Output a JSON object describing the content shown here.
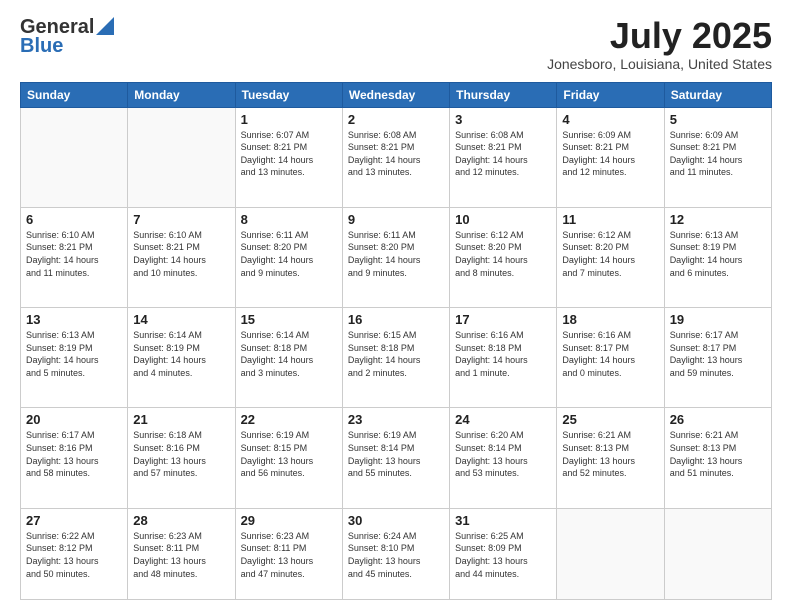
{
  "header": {
    "logo_line1": "General",
    "logo_line2": "Blue",
    "month_year": "July 2025",
    "location": "Jonesboro, Louisiana, United States"
  },
  "weekdays": [
    "Sunday",
    "Monday",
    "Tuesday",
    "Wednesday",
    "Thursday",
    "Friday",
    "Saturday"
  ],
  "weeks": [
    [
      {
        "day": "",
        "info": ""
      },
      {
        "day": "",
        "info": ""
      },
      {
        "day": "1",
        "info": "Sunrise: 6:07 AM\nSunset: 8:21 PM\nDaylight: 14 hours\nand 13 minutes."
      },
      {
        "day": "2",
        "info": "Sunrise: 6:08 AM\nSunset: 8:21 PM\nDaylight: 14 hours\nand 13 minutes."
      },
      {
        "day": "3",
        "info": "Sunrise: 6:08 AM\nSunset: 8:21 PM\nDaylight: 14 hours\nand 12 minutes."
      },
      {
        "day": "4",
        "info": "Sunrise: 6:09 AM\nSunset: 8:21 PM\nDaylight: 14 hours\nand 12 minutes."
      },
      {
        "day": "5",
        "info": "Sunrise: 6:09 AM\nSunset: 8:21 PM\nDaylight: 14 hours\nand 11 minutes."
      }
    ],
    [
      {
        "day": "6",
        "info": "Sunrise: 6:10 AM\nSunset: 8:21 PM\nDaylight: 14 hours\nand 11 minutes."
      },
      {
        "day": "7",
        "info": "Sunrise: 6:10 AM\nSunset: 8:21 PM\nDaylight: 14 hours\nand 10 minutes."
      },
      {
        "day": "8",
        "info": "Sunrise: 6:11 AM\nSunset: 8:20 PM\nDaylight: 14 hours\nand 9 minutes."
      },
      {
        "day": "9",
        "info": "Sunrise: 6:11 AM\nSunset: 8:20 PM\nDaylight: 14 hours\nand 9 minutes."
      },
      {
        "day": "10",
        "info": "Sunrise: 6:12 AM\nSunset: 8:20 PM\nDaylight: 14 hours\nand 8 minutes."
      },
      {
        "day": "11",
        "info": "Sunrise: 6:12 AM\nSunset: 8:20 PM\nDaylight: 14 hours\nand 7 minutes."
      },
      {
        "day": "12",
        "info": "Sunrise: 6:13 AM\nSunset: 8:19 PM\nDaylight: 14 hours\nand 6 minutes."
      }
    ],
    [
      {
        "day": "13",
        "info": "Sunrise: 6:13 AM\nSunset: 8:19 PM\nDaylight: 14 hours\nand 5 minutes."
      },
      {
        "day": "14",
        "info": "Sunrise: 6:14 AM\nSunset: 8:19 PM\nDaylight: 14 hours\nand 4 minutes."
      },
      {
        "day": "15",
        "info": "Sunrise: 6:14 AM\nSunset: 8:18 PM\nDaylight: 14 hours\nand 3 minutes."
      },
      {
        "day": "16",
        "info": "Sunrise: 6:15 AM\nSunset: 8:18 PM\nDaylight: 14 hours\nand 2 minutes."
      },
      {
        "day": "17",
        "info": "Sunrise: 6:16 AM\nSunset: 8:18 PM\nDaylight: 14 hours\nand 1 minute."
      },
      {
        "day": "18",
        "info": "Sunrise: 6:16 AM\nSunset: 8:17 PM\nDaylight: 14 hours\nand 0 minutes."
      },
      {
        "day": "19",
        "info": "Sunrise: 6:17 AM\nSunset: 8:17 PM\nDaylight: 13 hours\nand 59 minutes."
      }
    ],
    [
      {
        "day": "20",
        "info": "Sunrise: 6:17 AM\nSunset: 8:16 PM\nDaylight: 13 hours\nand 58 minutes."
      },
      {
        "day": "21",
        "info": "Sunrise: 6:18 AM\nSunset: 8:16 PM\nDaylight: 13 hours\nand 57 minutes."
      },
      {
        "day": "22",
        "info": "Sunrise: 6:19 AM\nSunset: 8:15 PM\nDaylight: 13 hours\nand 56 minutes."
      },
      {
        "day": "23",
        "info": "Sunrise: 6:19 AM\nSunset: 8:14 PM\nDaylight: 13 hours\nand 55 minutes."
      },
      {
        "day": "24",
        "info": "Sunrise: 6:20 AM\nSunset: 8:14 PM\nDaylight: 13 hours\nand 53 minutes."
      },
      {
        "day": "25",
        "info": "Sunrise: 6:21 AM\nSunset: 8:13 PM\nDaylight: 13 hours\nand 52 minutes."
      },
      {
        "day": "26",
        "info": "Sunrise: 6:21 AM\nSunset: 8:13 PM\nDaylight: 13 hours\nand 51 minutes."
      }
    ],
    [
      {
        "day": "27",
        "info": "Sunrise: 6:22 AM\nSunset: 8:12 PM\nDaylight: 13 hours\nand 50 minutes."
      },
      {
        "day": "28",
        "info": "Sunrise: 6:23 AM\nSunset: 8:11 PM\nDaylight: 13 hours\nand 48 minutes."
      },
      {
        "day": "29",
        "info": "Sunrise: 6:23 AM\nSunset: 8:11 PM\nDaylight: 13 hours\nand 47 minutes."
      },
      {
        "day": "30",
        "info": "Sunrise: 6:24 AM\nSunset: 8:10 PM\nDaylight: 13 hours\nand 45 minutes."
      },
      {
        "day": "31",
        "info": "Sunrise: 6:25 AM\nSunset: 8:09 PM\nDaylight: 13 hours\nand 44 minutes."
      },
      {
        "day": "",
        "info": ""
      },
      {
        "day": "",
        "info": ""
      }
    ]
  ]
}
